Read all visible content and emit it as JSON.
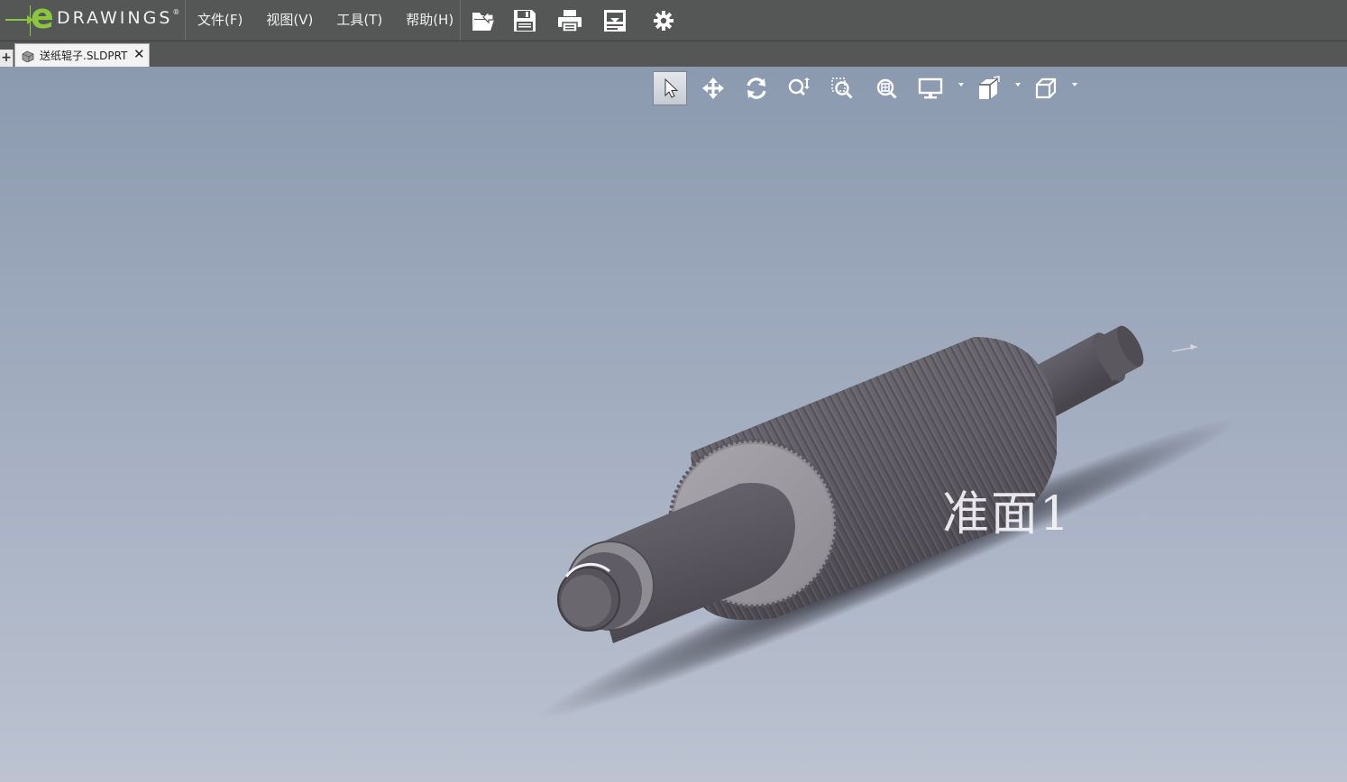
{
  "app": {
    "logo_letter": "e",
    "logo_word": "DRAWINGS",
    "logo_mark": "®"
  },
  "menu": [
    {
      "label": "文件(F)"
    },
    {
      "label": "视图(V)"
    },
    {
      "label": "工具(T)"
    },
    {
      "label": "帮助(H)"
    }
  ],
  "toolbar_icons": [
    "open-icon",
    "save-icon",
    "print-icon",
    "markup-icon",
    "settings-gear-icon"
  ],
  "tab": {
    "new_tab": "+",
    "file_name": "送纸辊子.SLDPRT",
    "close": "✕"
  },
  "view_toolbar": [
    "select-arrow-icon",
    "pan-icon",
    "rotate-icon",
    "zoom-icon",
    "zoom-to-area-icon",
    "zoom-to-fit-icon",
    "display-style-icon",
    "section-view-icon",
    "standard-views-icon"
  ],
  "viewport": {
    "plane_label": "准面1"
  },
  "colors": {
    "accent_green": "#8cc63f",
    "titlebar": "#555756"
  }
}
